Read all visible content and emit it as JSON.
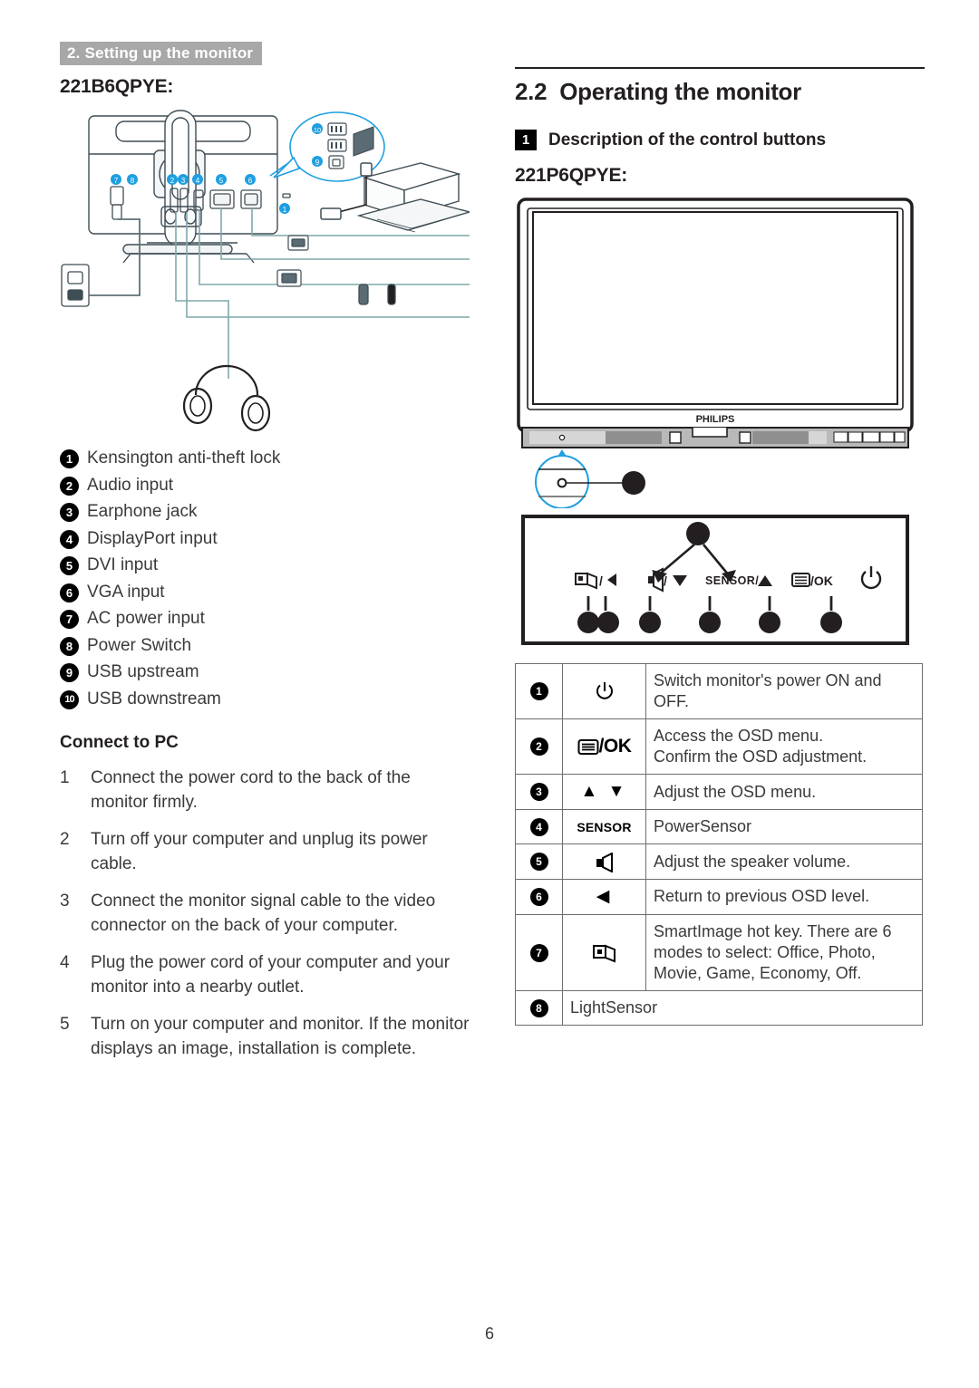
{
  "header": {
    "running_head": "2. Setting up the monitor"
  },
  "left": {
    "model_title": "221B6QPYE:",
    "figure_alt": "rear-connection-diagram",
    "legend": [
      {
        "n": "1",
        "label": "Kensington anti-theft lock"
      },
      {
        "n": "2",
        "label": "Audio input"
      },
      {
        "n": "3",
        "label": "Earphone jack"
      },
      {
        "n": "4",
        "label": "DisplayPort input"
      },
      {
        "n": "5",
        "label": "DVI input"
      },
      {
        "n": "6",
        "label": "VGA input"
      },
      {
        "n": "7",
        "label": "AC power input"
      },
      {
        "n": "8",
        "label": "Power Switch"
      },
      {
        "n": "9",
        "label": "USB upstream"
      },
      {
        "n": "10",
        "label": "USB downstream"
      }
    ],
    "connect_heading": "Connect to PC",
    "steps": [
      {
        "n": "1",
        "text": "Connect the power cord to the back of the monitor firmly."
      },
      {
        "n": "2",
        "text": "Turn off your computer and unplug its power cable."
      },
      {
        "n": "3",
        "text": "Connect the monitor signal cable to the video connector on the back of your computer."
      },
      {
        "n": "4",
        "text": "Plug the power cord of your computer and your monitor into a nearby outlet."
      },
      {
        "n": "5",
        "text": "Turn on your computer and monitor. If the monitor displays an image, installation is complete."
      }
    ]
  },
  "right": {
    "section_number": "2.2",
    "section_title": "Operating the monitor",
    "sub_badge": "1",
    "sub_title": "Description of the control buttons",
    "model_title": "221P6QPYE:",
    "monitor_brand": "PHILIPS",
    "panel_labels": [
      "/",
      "/",
      "SENSOR /",
      "/OK",
      ""
    ],
    "panel_label_texts": [
      {
        "icon": "smartimage-icon",
        "text": "/◀"
      },
      {
        "icon": "volume-icon",
        "text": "/▼"
      },
      {
        "icon": "sensor-text",
        "text": "SENSOR/▲"
      },
      {
        "icon": "menu-icon",
        "text": "/OK"
      },
      {
        "icon": "power-icon",
        "text": ""
      }
    ],
    "table": [
      {
        "n": "1",
        "icon": "power-icon",
        "icon_text": "",
        "desc": "Switch monitor's power ON and OFF."
      },
      {
        "n": "2",
        "icon": "menu-ok-icon",
        "icon_text": "/OK",
        "desc": "Access the OSD menu.\nConfirm the OSD adjustment."
      },
      {
        "n": "3",
        "icon": "up-down-icon",
        "icon_text": "▲ ▼",
        "desc": "Adjust the OSD menu."
      },
      {
        "n": "4",
        "icon": "sensor-icon",
        "icon_text": "SENSOR",
        "desc": "PowerSensor"
      },
      {
        "n": "5",
        "icon": "speaker-icon",
        "icon_text": "",
        "desc": "Adjust the speaker volume."
      },
      {
        "n": "6",
        "icon": "left-arrow-icon",
        "icon_text": "◀",
        "desc": "Return to previous OSD level."
      },
      {
        "n": "7",
        "icon": "smartimage-icon",
        "icon_text": "",
        "desc": "SmartImage hot key. There are 6 modes to select: Office, Photo, Movie, Game, Economy, Off."
      },
      {
        "n": "8",
        "icon": "",
        "icon_text": "",
        "desc": "LightSensor",
        "full_width": true
      }
    ]
  },
  "footer": {
    "page_number": "6"
  },
  "colors": {
    "header_bg": "#a8a8a8",
    "text": "#231f20",
    "body_text": "#3a3a3a",
    "callout_blue": "#1f9fe0",
    "rule": "#231f20"
  }
}
